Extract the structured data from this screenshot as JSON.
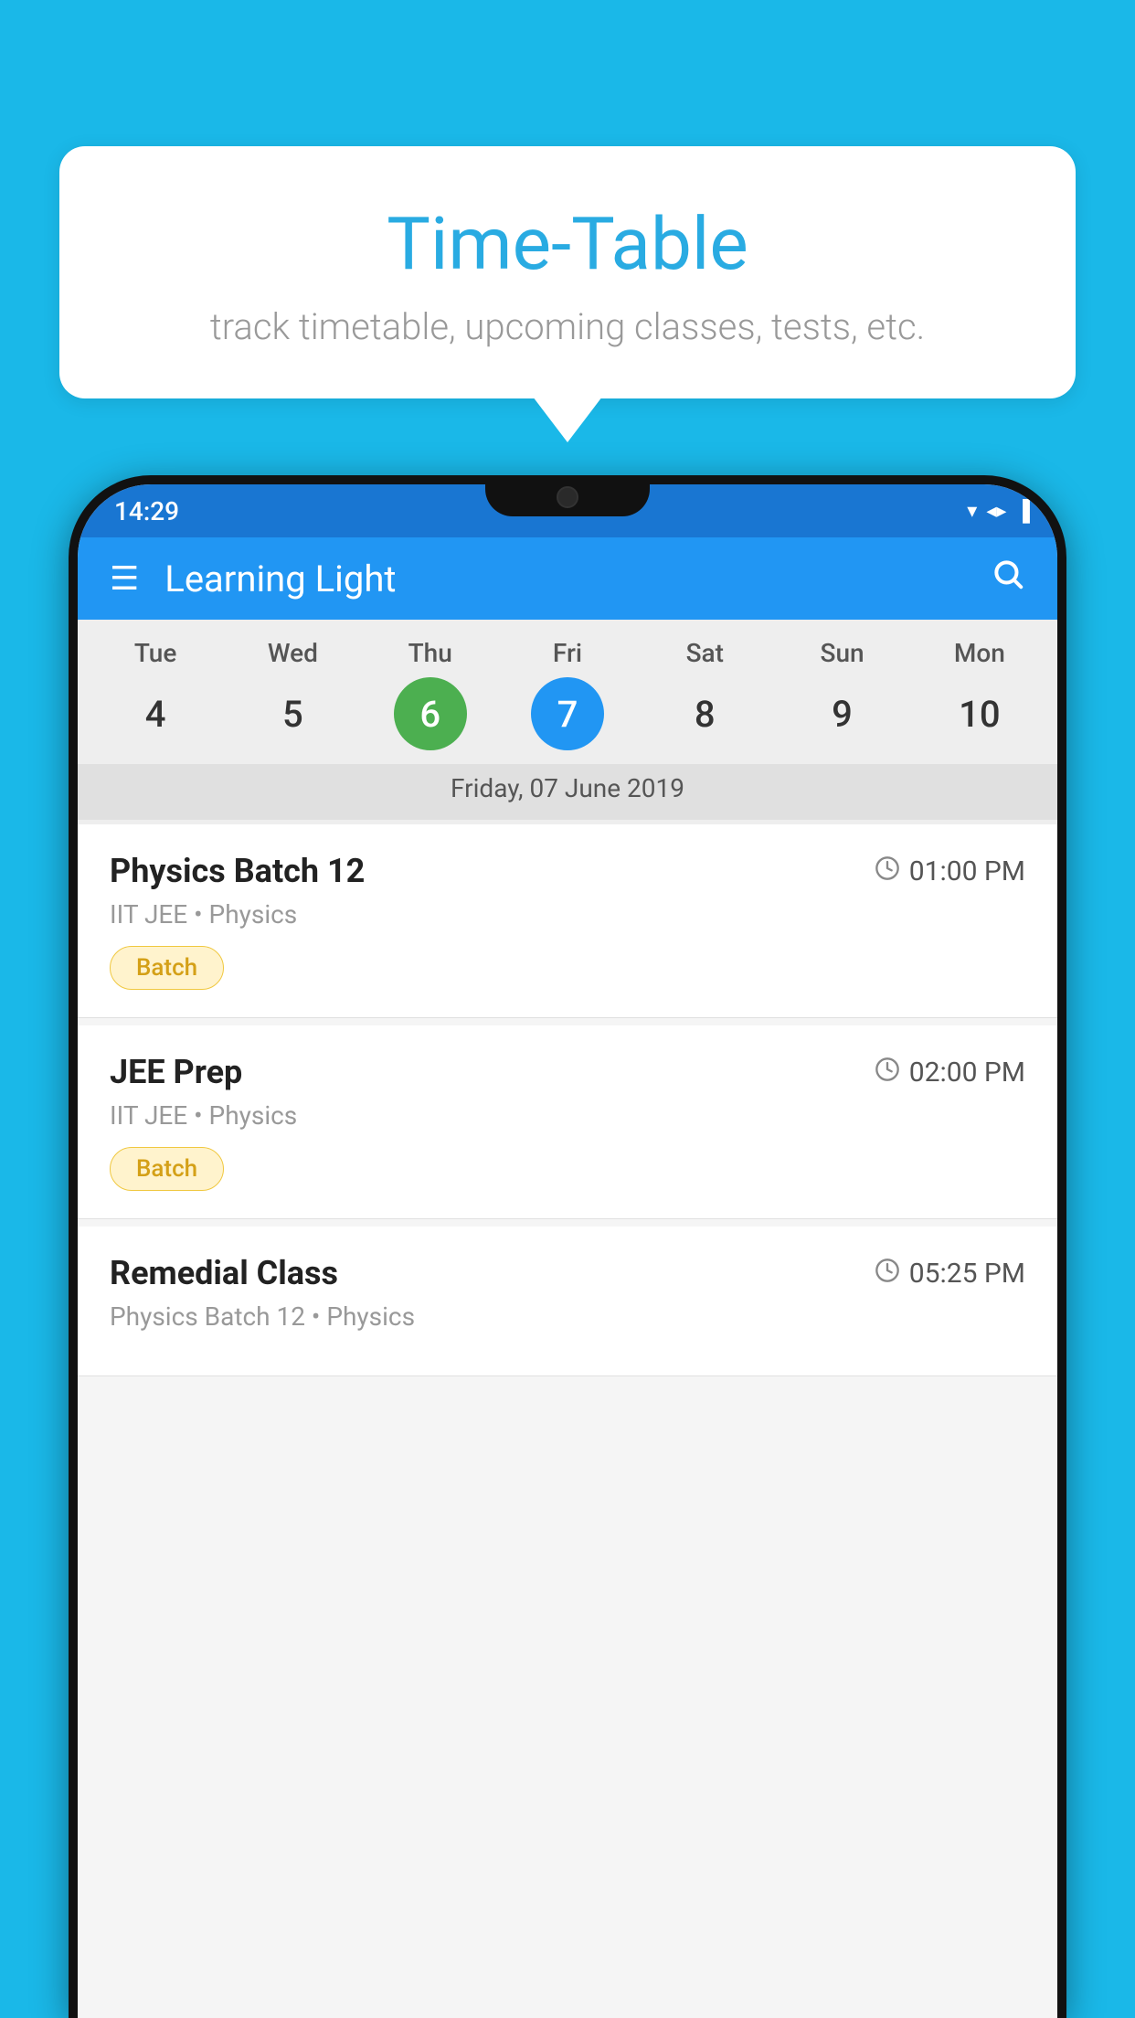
{
  "background_color": "#1ab8e8",
  "tooltip": {
    "title": "Time-Table",
    "subtitle": "track timetable, upcoming classes, tests, etc."
  },
  "phone": {
    "status_bar": {
      "time": "14:29",
      "icons": [
        "wifi",
        "signal",
        "battery"
      ]
    },
    "app_bar": {
      "title": "Learning Light",
      "has_hamburger": true,
      "has_search": true
    },
    "calendar": {
      "days": [
        {
          "label": "Tue",
          "num": "4"
        },
        {
          "label": "Wed",
          "num": "5"
        },
        {
          "label": "Thu",
          "num": "6",
          "state": "today"
        },
        {
          "label": "Fri",
          "num": "7",
          "state": "selected"
        },
        {
          "label": "Sat",
          "num": "8"
        },
        {
          "label": "Sun",
          "num": "9"
        },
        {
          "label": "Mon",
          "num": "10"
        }
      ],
      "selected_date": "Friday, 07 June 2019"
    },
    "classes": [
      {
        "name": "Physics Batch 12",
        "time": "01:00 PM",
        "info": "IIT JEE • Physics",
        "badge": "Batch"
      },
      {
        "name": "JEE Prep",
        "time": "02:00 PM",
        "info": "IIT JEE • Physics",
        "badge": "Batch"
      },
      {
        "name": "Remedial Class",
        "time": "05:25 PM",
        "info": "Physics Batch 12 • Physics",
        "badge": null
      }
    ]
  }
}
